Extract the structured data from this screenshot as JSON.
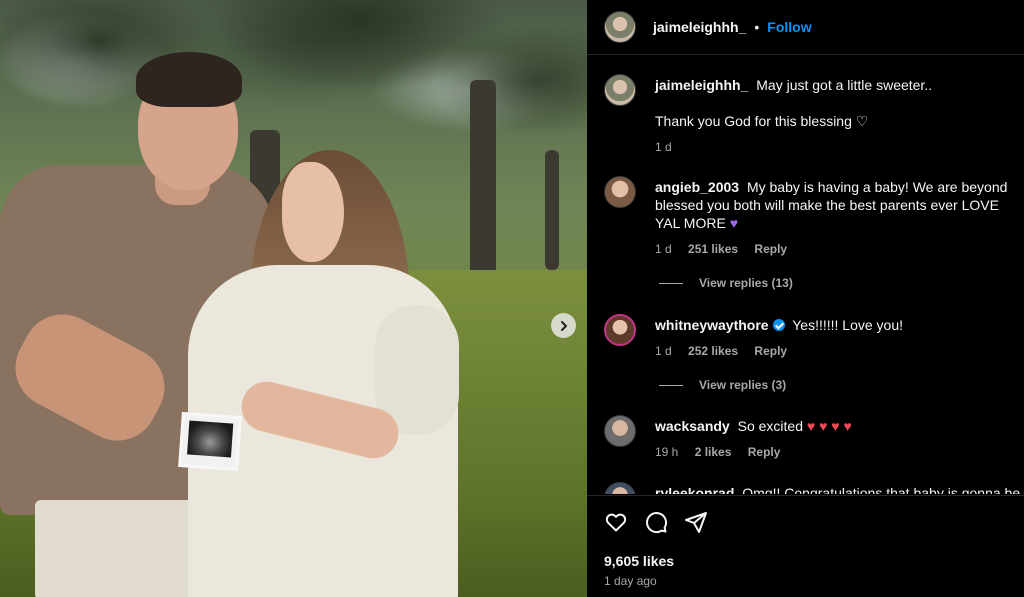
{
  "post": {
    "username": "jaimeleighhh_",
    "follow_label": "Follow",
    "dot": "•",
    "caption_line1": "May just got a little sweeter..",
    "caption_line2": "Thank you God for this blessing",
    "caption_heart": "♡",
    "caption_age": "1 d",
    "likes": "9,605 likes",
    "posted": "1 day ago"
  },
  "comments": [
    {
      "username": "angieb_2003",
      "text": "My baby is having a baby! We are beyond blessed you both will make the best parents ever LOVE YAL MORE",
      "emoji": "♥",
      "age": "1 d",
      "likes": "251 likes",
      "reply": "Reply",
      "view_replies": "View replies (13)"
    },
    {
      "username": "whitneywaythore",
      "verified": true,
      "text": "Yes!!!!!! Love you!",
      "age": "1 d",
      "likes": "252 likes",
      "reply": "Reply",
      "view_replies": "View replies (3)"
    },
    {
      "username": "wacksandy",
      "text": "So excited",
      "emoji": "♥ ♥ ♥ ♥",
      "age": "19 h",
      "likes": "2 likes",
      "reply": "Reply"
    },
    {
      "username": "ryleekonrad",
      "text": "Omg!! Congratulations that baby is gonna be"
    }
  ],
  "colors": {
    "accent": "#0095f6",
    "heart": "#ed4956",
    "muted": "#a8a8a8"
  },
  "icons": [
    "chevron-right-icon",
    "heart-icon",
    "comment-icon",
    "share-icon",
    "verified-icon"
  ]
}
